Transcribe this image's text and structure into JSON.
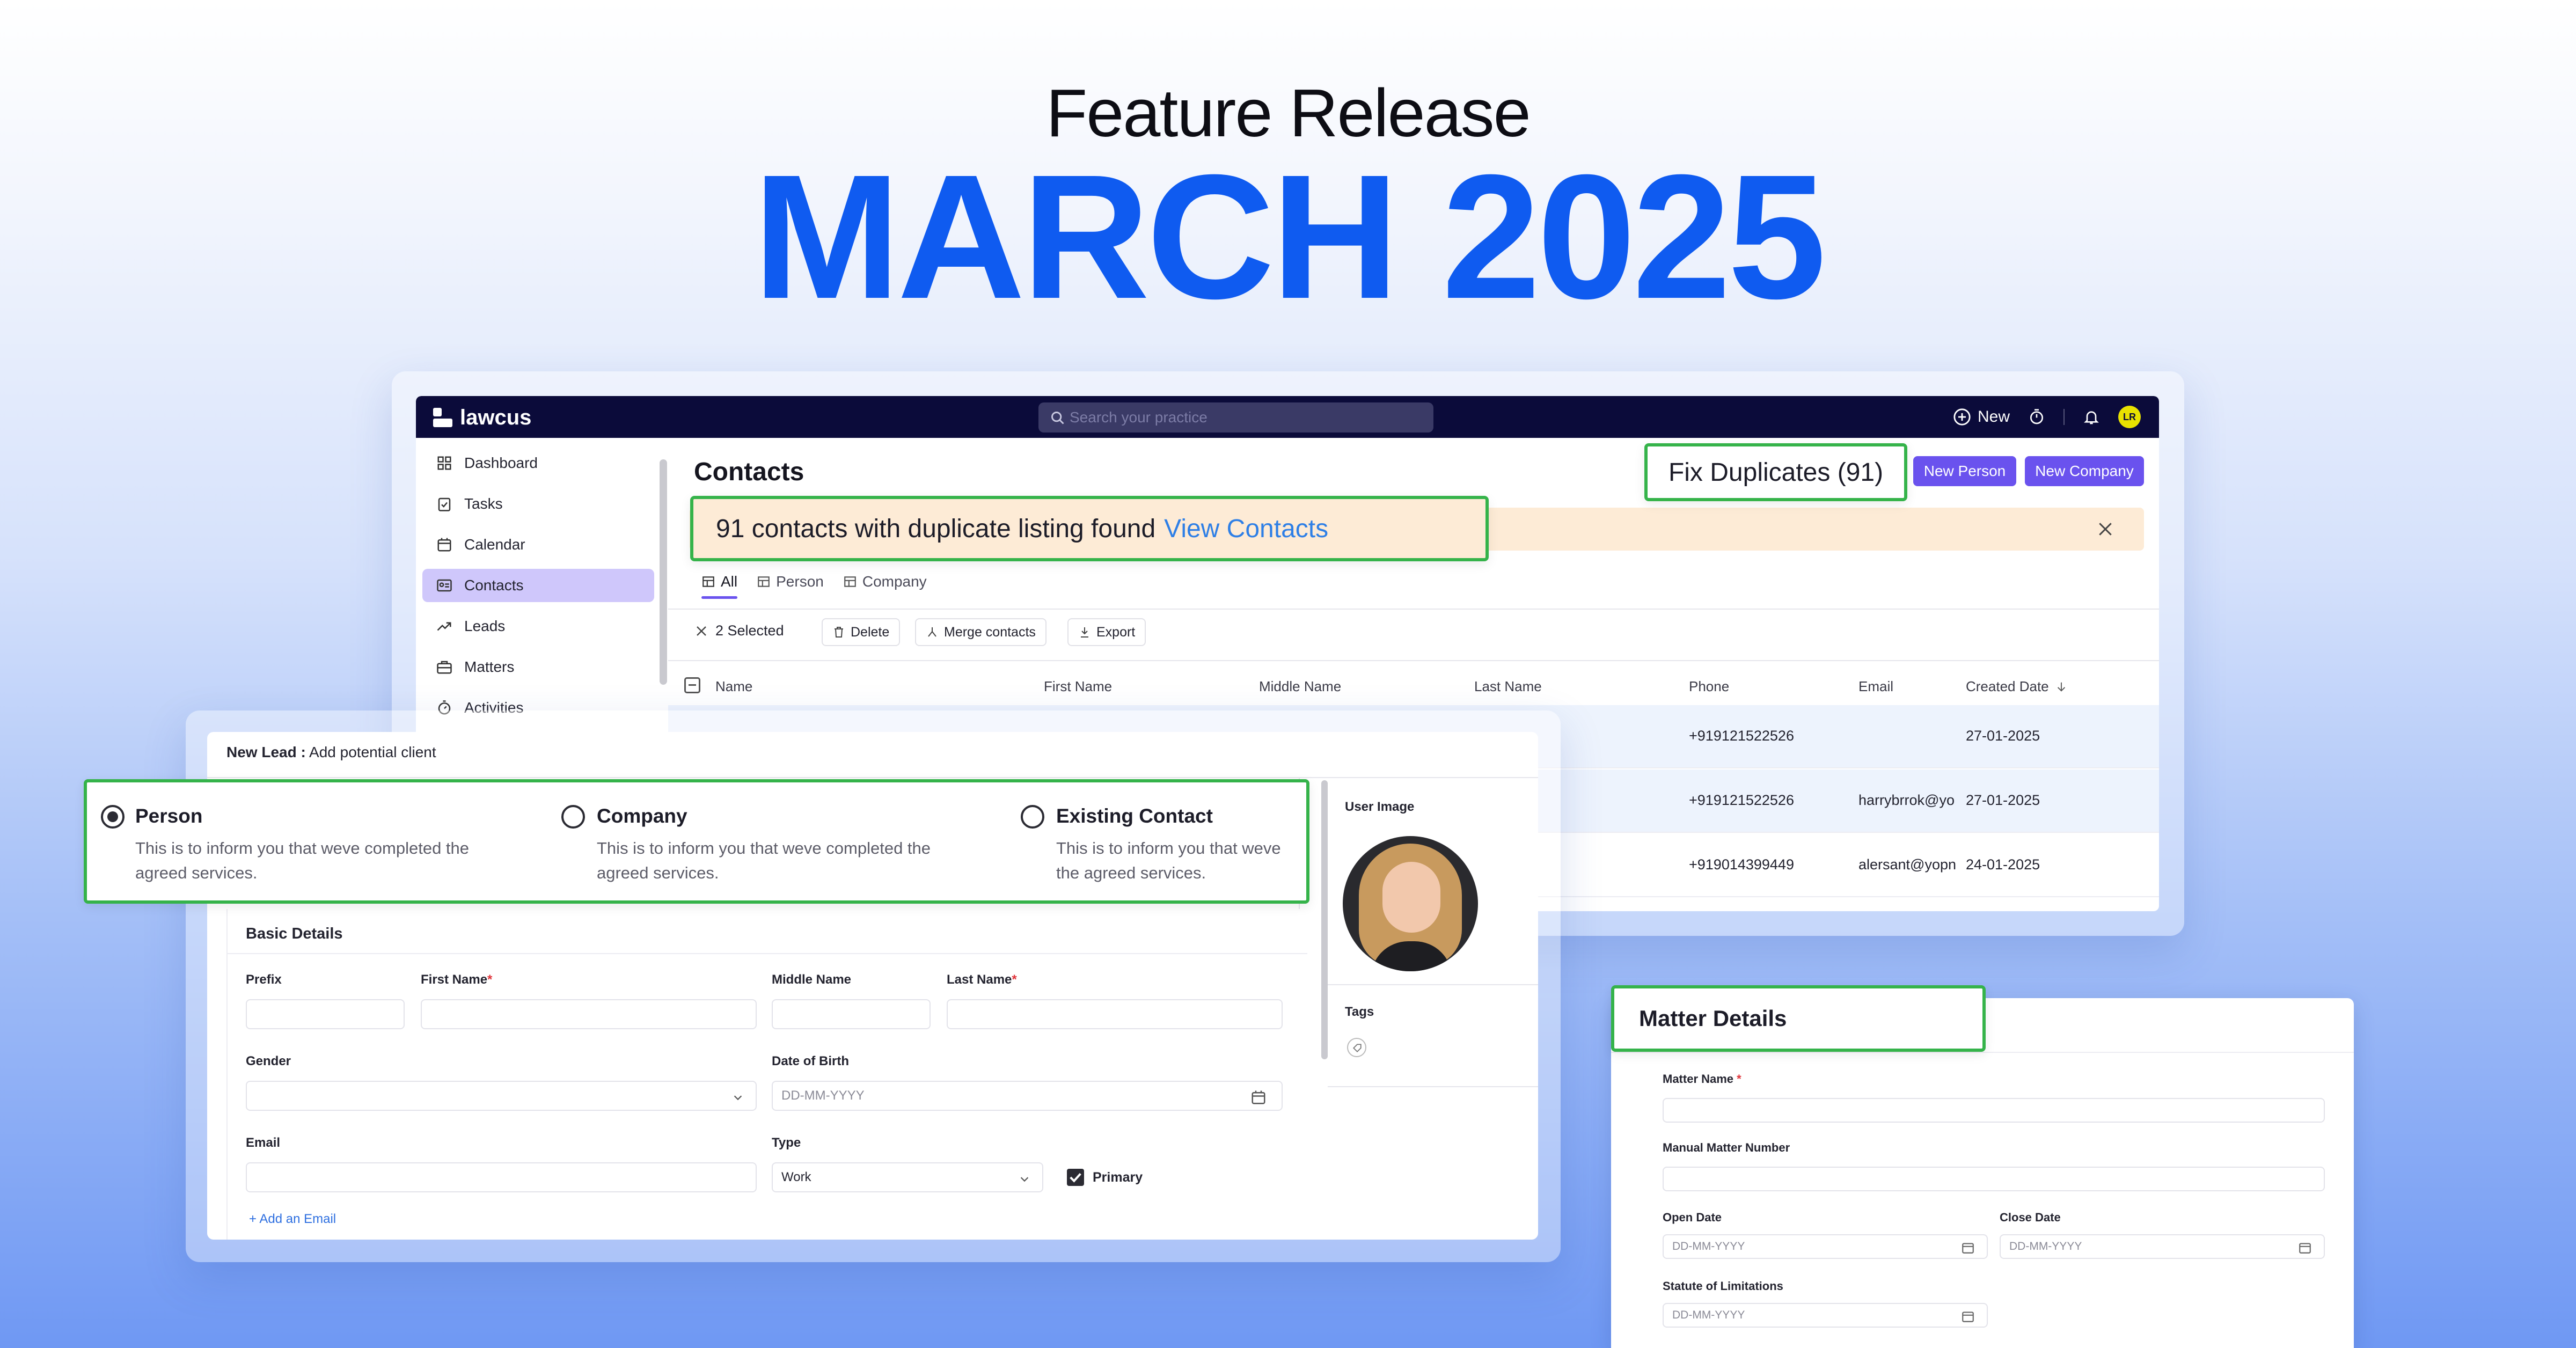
{
  "hero": {
    "subtitle": "Feature Release",
    "title": "MARCH 2025"
  },
  "app": {
    "brand": "lawcus",
    "search_placeholder": "Search your practice",
    "new_label": "New",
    "avatar_initials": "LR",
    "sidebar": [
      "Dashboard",
      "Tasks",
      "Calendar",
      "Contacts",
      "Leads",
      "Matters",
      "Activities"
    ],
    "active_item": "Contacts"
  },
  "contacts": {
    "title": "Contacts",
    "fix_duplicates": "Fix Duplicates (91)",
    "new_person": "New Person",
    "new_company": "New Company",
    "banner_text": "91 contacts with duplicate listing found",
    "banner_link": "View Contacts",
    "tabs": [
      "All",
      "Person",
      "Company"
    ],
    "selected": "2 Selected",
    "actions": [
      "Delete",
      "Merge contacts",
      "Export"
    ],
    "columns": [
      "Name",
      "First Name",
      "Middle Name",
      "Last Name",
      "Phone",
      "Email",
      "Created Date"
    ],
    "rows": [
      {
        "phone": "+919121522526",
        "email": "",
        "date": "27-01-2025"
      },
      {
        "phone": "+919121522526",
        "email": "harrybrrok@yo",
        "date": "27-01-2025"
      },
      {
        "phone": "+919014399449",
        "email": "alersant@yopn",
        "date": "24-01-2025"
      }
    ]
  },
  "lead": {
    "header_bold": "New Lead :",
    "header_rest": "Add potential client",
    "options": [
      {
        "title": "Person",
        "desc": "This is to inform you that weve completed the agreed services.",
        "selected": true
      },
      {
        "title": "Company",
        "desc": "This is to inform you that weve completed the agreed services.",
        "selected": false
      },
      {
        "title": "Existing Contact",
        "desc": "This is to inform you that weve the agreed services.",
        "selected": false
      }
    ],
    "section": "Basic Details",
    "labels": {
      "prefix": "Prefix",
      "first": "First Name",
      "middle": "Middle Name",
      "last": "Last Name",
      "gender": "Gender",
      "dob": "Date of Birth",
      "email": "Email",
      "type": "Type"
    },
    "dob_placeholder": "DD-MM-YYYY",
    "type_value": "Work",
    "primary": "Primary",
    "add_email": "+ Add an Email",
    "user_image": "User Image",
    "tags": "Tags"
  },
  "matter": {
    "title": "Matter Details",
    "name_label": "Matter Name",
    "number_label": "Manual Matter Number",
    "open_label": "Open Date",
    "close_label": "Close Date",
    "sol_label": "Statute of Limitations",
    "date_placeholder": "DD-MM-YYYY"
  }
}
